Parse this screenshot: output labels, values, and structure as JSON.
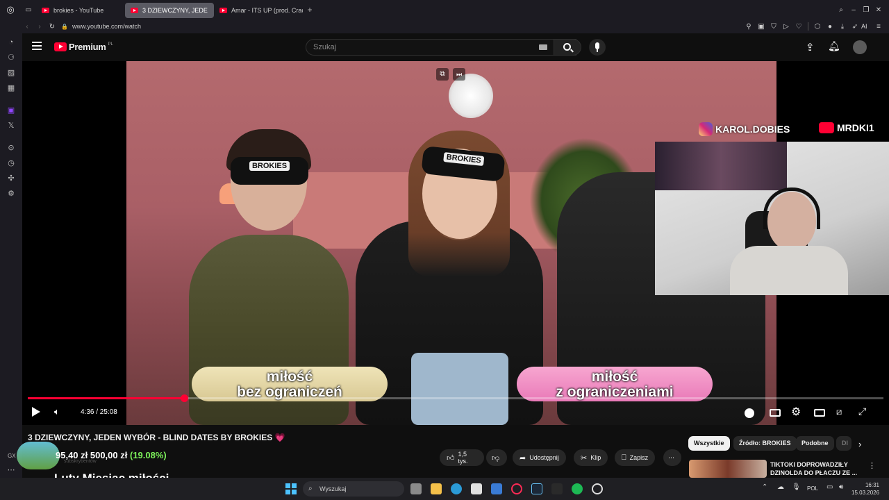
{
  "browser": {
    "tabs": [
      {
        "label": "brokies - YouTube",
        "active": false
      },
      {
        "label": "3 DZIEWCZYNY, JEDE",
        "active": true
      },
      {
        "label": "Amar - ITS UP (prod. Crac",
        "active": false
      }
    ],
    "url": "www.youtube.com/watch",
    "ai_label": "AI"
  },
  "youtube": {
    "logo_text": "Premium",
    "logo_sup": "PL",
    "search_placeholder": "Szukaj"
  },
  "video": {
    "overlay_instagram": "KAROL.DOBIES",
    "overlay_youtube": "MRDKI1",
    "mask_label": "BROKIES",
    "pill_left_line1": "miłość",
    "pill_left_line2": "bez ograniczeń",
    "pill_right_line1": "miłość",
    "pill_right_line2": "z ograniczeniami",
    "time": "4:36 / 25:08",
    "progress": 0.183
  },
  "below": {
    "title": "3 DZIEWCZYNY, JEDEN WYBÓR - BLIND DATES BY BROKIES 💗",
    "likes": "1,5 tys.",
    "share": "Udostępnij",
    "clip": "Klip",
    "save": "Zapisz",
    "chips": [
      "Wszystkie",
      "Źródło: BROKIES",
      "Podobne",
      "Dl"
    ],
    "recommended_title_1": "TIKTOKI DOPROWADZIŁY",
    "recommended_title_2": "DZINOLDA DO PŁACZU ZE ...",
    "price_text": "95,40 zł   500,00 zł",
    "price_percent": "(19.08%)",
    "banner": "Luty Miesiąc miłości",
    "subs_ghost": "subskrybentów",
    "gx_label": "GX"
  },
  "taskbar": {
    "search": "Wyszukaj",
    "lang": "POL",
    "time": "16:31",
    "date": "15.03.2026"
  },
  "colors": {
    "accent": "#ff0033",
    "pill_left": "#e8d9a8",
    "pill_right": "#f28fc4",
    "percent": "#7cf05a"
  }
}
